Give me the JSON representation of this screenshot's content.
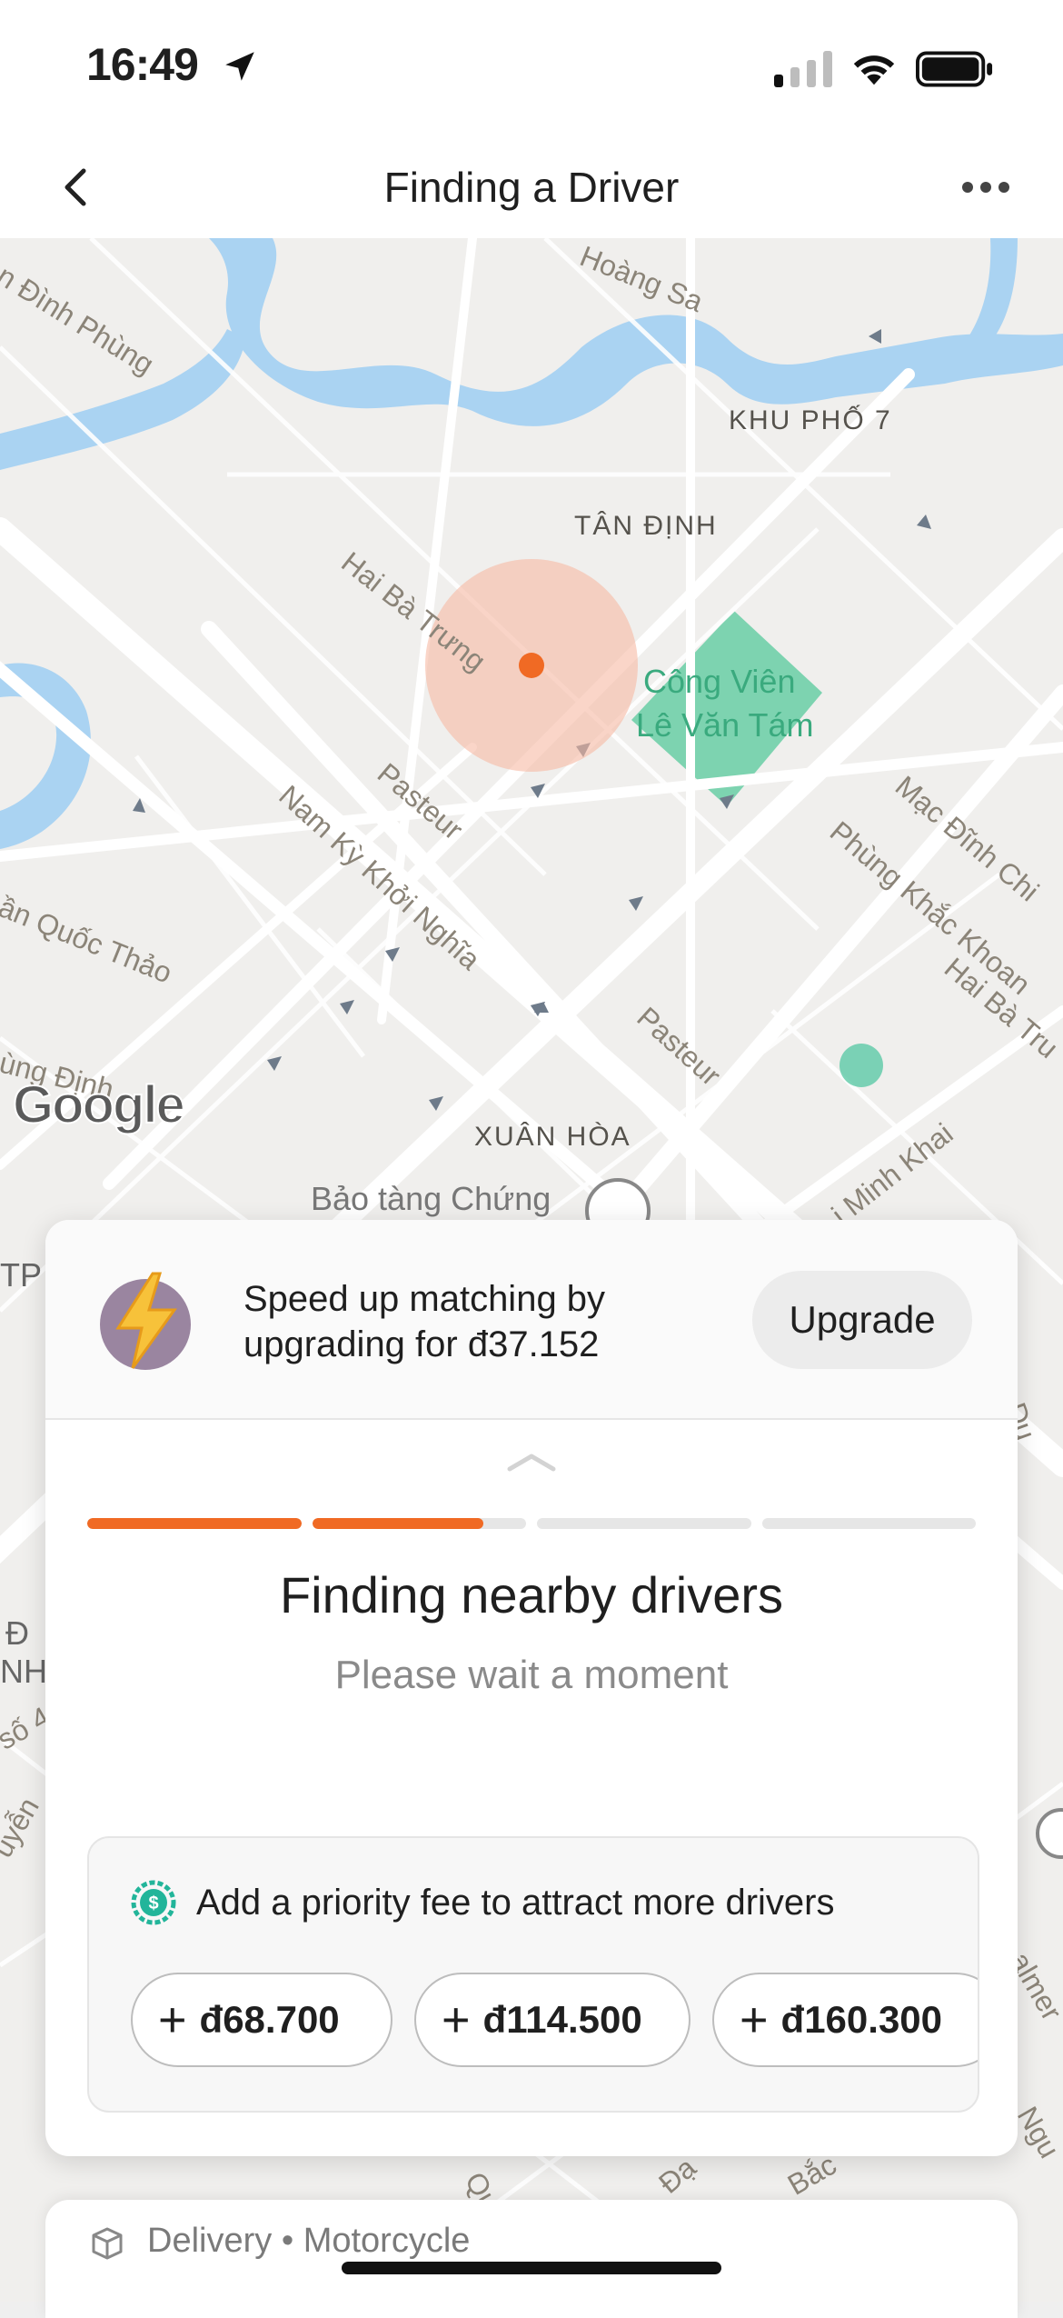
{
  "status_bar": {
    "time": "16:49"
  },
  "nav": {
    "title": "Finding a Driver",
    "back_icon": "chevron-left-icon",
    "more_icon": "ellipsis-icon"
  },
  "map": {
    "labels": {
      "dinh_phung": "n Đình Phùng",
      "hoang_sa": "Hoàng Sa",
      "khu_pho_7": "KHU PHỐ 7",
      "tan_dinh": "TÂN ĐỊNH",
      "hai_ba_trung": "Hai Bà Trưng",
      "cong_vien_1": "Công Viên",
      "cong_vien_2": "Lê Văn Tám",
      "pasteur_1": "Pasteur",
      "nam_ky": "Nam Kỳ Khởi Nghĩa",
      "quoc_thao": "ần Quốc Thảo",
      "mac_dinh_chi": "Mạc Đĩnh Chi",
      "phung_khac_khoan": "Phùng Khắc Khoan",
      "hai_ba_tru_2": "Hai Bà Tru",
      "ung_dinh": "ùng Định",
      "pasteur_2": "Pasteur",
      "xuan_hoa": "XUÂN HÒA",
      "bao_tang": "Bảo tàng Chứng",
      "minh_khai": "i Minh Khai",
      "tp": "TP",
      "d_label": "Đ",
      "nh_label": "NH",
      "so4": "số 4",
      "du": "Du",
      "uyen": "uyễn",
      "almer": "almer",
      "ngu": "Ngu",
      "quy": "Quý",
      "dac": "Đạ",
      "bac": "Bắc"
    },
    "google_logo": "Google",
    "pickup_color": "#f06a24"
  },
  "upgrade": {
    "icon": "lightning-bolt-icon",
    "text_line1": "Speed up matching by",
    "text_line2": "upgrading for đ37.152",
    "button_label": "Upgrade"
  },
  "search": {
    "progress_segments": [
      1.0,
      0.8,
      0.0,
      0.0
    ],
    "title": "Finding nearby drivers",
    "subtitle": "Please wait a moment"
  },
  "priority": {
    "icon": "coin-icon",
    "label": "Add a priority fee to attract more drivers",
    "fees": [
      "đ68.700",
      "đ114.500",
      "đ160.300"
    ],
    "plus_symbol": "+"
  },
  "delivery": {
    "icon": "package-icon",
    "service": "Delivery",
    "separator": "•",
    "vehicle": "Motorcycle"
  },
  "colors": {
    "accent": "#f06a24",
    "park": "#7dd3b0",
    "water": "#aad3f2"
  }
}
